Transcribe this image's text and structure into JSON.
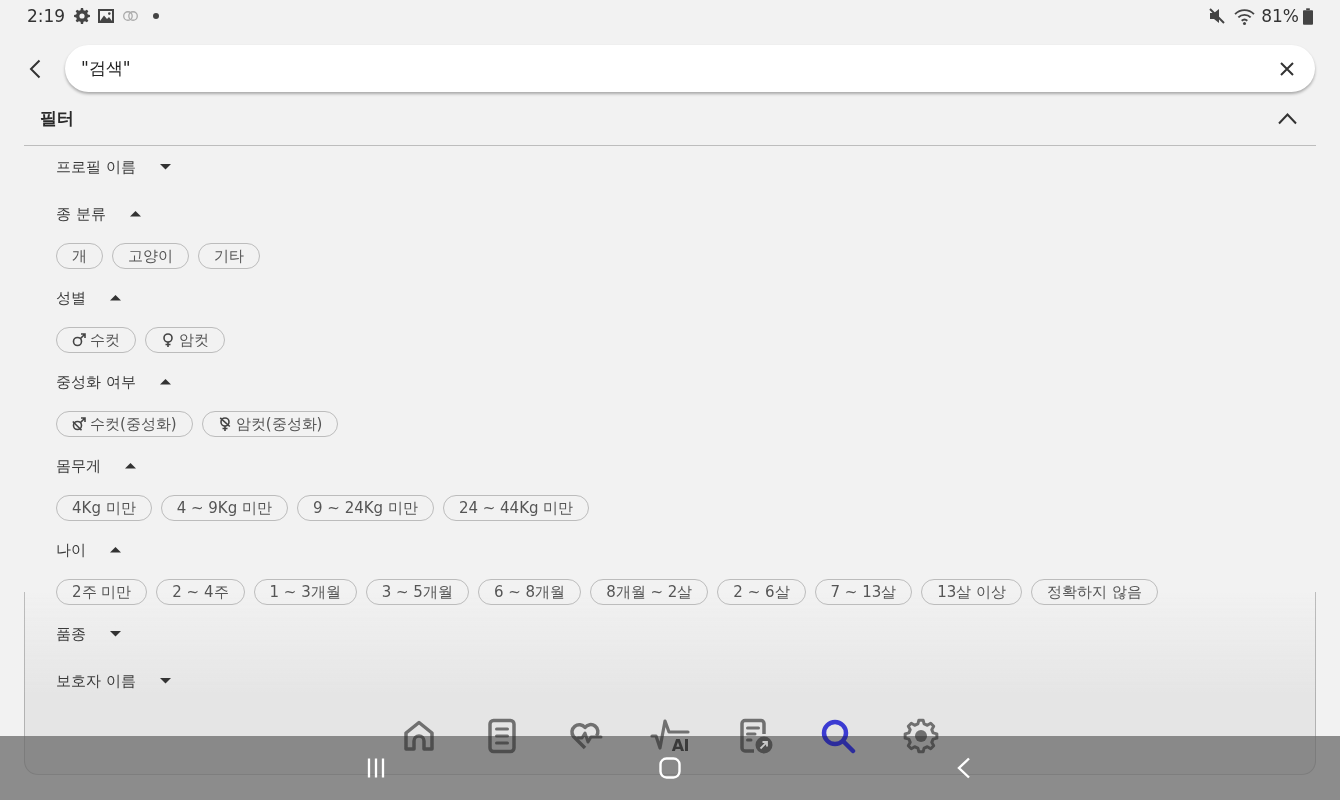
{
  "status_bar": {
    "time": "2:19",
    "battery": "81%"
  },
  "search": {
    "value": "\"검색\""
  },
  "filter": {
    "title": "필터",
    "expanded": true,
    "sections": [
      {
        "label": "프로필 이름",
        "expanded": false
      },
      {
        "label": "종 분류",
        "expanded": true,
        "options": [
          {
            "label": "개",
            "selected": false
          },
          {
            "label": "고양이",
            "selected": false
          },
          {
            "label": "기타",
            "selected": false
          }
        ]
      },
      {
        "label": "성별",
        "expanded": true,
        "options": [
          {
            "label": "수컷",
            "kind": "male",
            "selected": false
          },
          {
            "label": "암컷",
            "kind": "female",
            "selected": false
          }
        ]
      },
      {
        "label": "중성화 여부",
        "expanded": true,
        "options": [
          {
            "label": "수컷(중성화)",
            "kind": "male-neutered",
            "selected": false
          },
          {
            "label": "암컷(중성화)",
            "kind": "female-neutered",
            "selected": false
          }
        ]
      },
      {
        "label": "몸무게",
        "expanded": true,
        "options": [
          {
            "label": "4Kg 미만",
            "selected": false
          },
          {
            "label": "4 ~ 9Kg 미만",
            "selected": false
          },
          {
            "label": "9 ~ 24Kg 미만",
            "selected": false
          },
          {
            "label": "24 ~ 44Kg 미만",
            "selected": false
          }
        ]
      },
      {
        "label": "나이",
        "expanded": true,
        "options": [
          {
            "label": "2주 미만",
            "selected": false
          },
          {
            "label": "2 ~ 4주",
            "selected": false
          },
          {
            "label": "1 ~ 3개월",
            "selected": false
          },
          {
            "label": "3 ~ 5개월",
            "selected": false
          },
          {
            "label": "6 ~ 8개월",
            "selected": false
          },
          {
            "label": "8개월 ~ 2살",
            "selected": false
          },
          {
            "label": "2 ~ 6살",
            "selected": false
          },
          {
            "label": "7 ~ 13살",
            "selected": false
          },
          {
            "label": "13살 이상",
            "selected": false
          },
          {
            "label": "정확하지 않음",
            "selected": false
          }
        ]
      },
      {
        "label": "품종",
        "expanded": false
      },
      {
        "label": "보호자 이름",
        "expanded": false
      }
    ]
  },
  "nav_tabs": [
    {
      "selected": false
    },
    {
      "selected": false
    },
    {
      "selected": false
    },
    {
      "selected": false,
      "label": "AI"
    },
    {
      "selected": false
    },
    {
      "selected": true
    },
    {
      "selected": false
    }
  ]
}
